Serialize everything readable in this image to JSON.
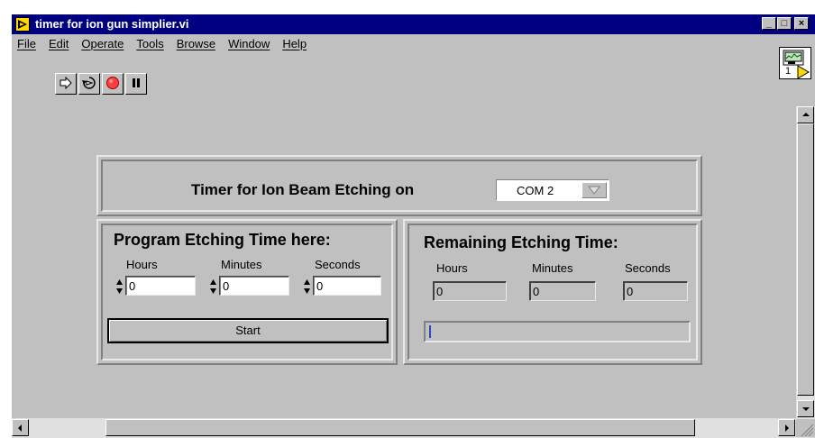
{
  "window": {
    "title": "timer for ion gun simplier.vi",
    "buttons": {
      "minimize": "_",
      "maximize": "□",
      "close": "×"
    }
  },
  "menu": {
    "items": [
      "File",
      "Edit",
      "Operate",
      "Tools",
      "Browse",
      "Window",
      "Help"
    ]
  },
  "toolbar": {
    "icons": [
      "run-arrow-icon",
      "run-continuous-icon",
      "abort-icon",
      "pause-icon"
    ],
    "vi_icon_number": "1"
  },
  "panel": {
    "header_text": "Timer for Ion Beam Etching on",
    "port_value": "COM 2",
    "program": {
      "heading": "Program Etching Time here:",
      "hours_label": "Hours",
      "minutes_label": "Minutes",
      "seconds_label": "Seconds",
      "hours_value": "0",
      "minutes_value": "0",
      "seconds_value": "0",
      "start_label": "Start"
    },
    "remaining": {
      "heading": "Remaining Etching Time:",
      "hours_label": "Hours",
      "minutes_label": "Minutes",
      "seconds_label": "Seconds",
      "hours_value": "0",
      "minutes_value": "0",
      "seconds_value": "0",
      "progress": 0
    }
  },
  "colors": {
    "titlebar": "#000080",
    "face": "#c0c0c0",
    "abort": "#ff4040"
  }
}
